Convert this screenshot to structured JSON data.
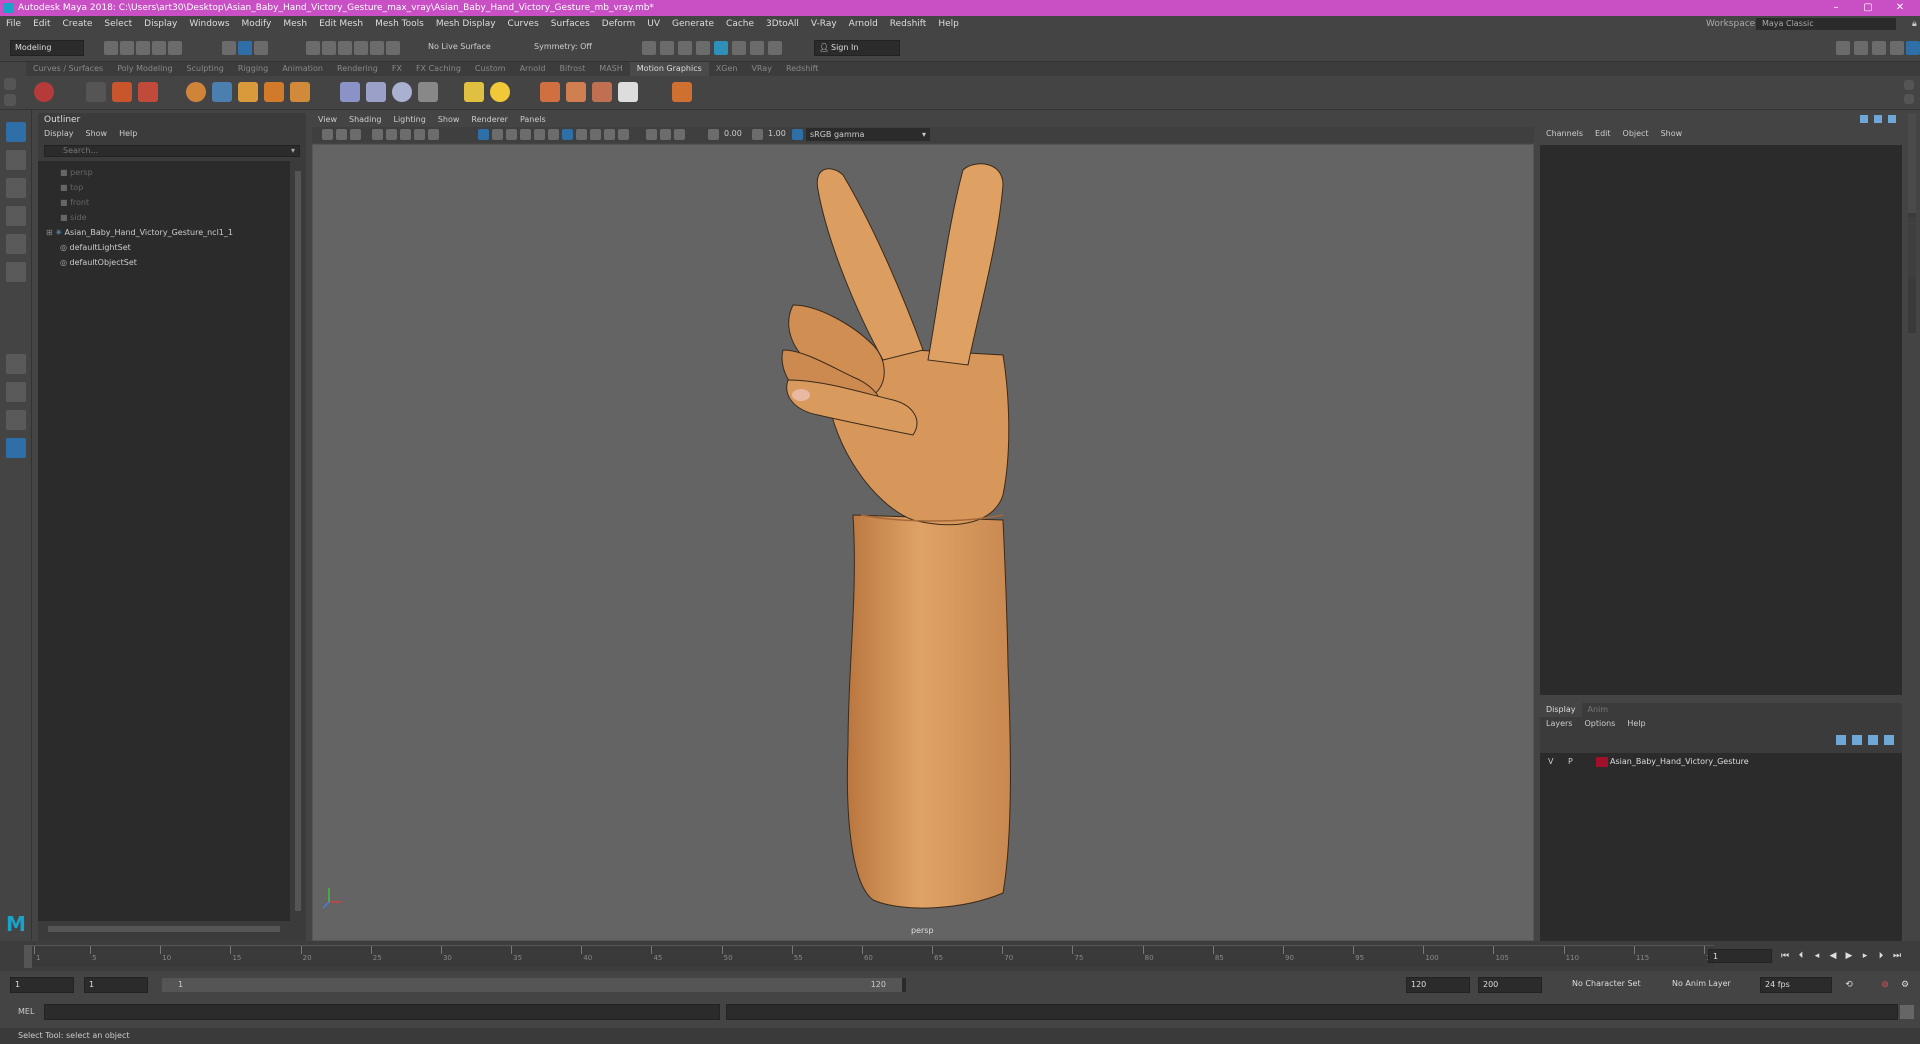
{
  "window": {
    "title": "Autodesk Maya 2018: C:\\Users\\art30\\Desktop\\Asian_Baby_Hand_Victory_Gesture_max_vray\\Asian_Baby_Hand_Victory_Gesture_mb_vray.mb*",
    "minimize": "–",
    "maximize": "▢",
    "close": "✕"
  },
  "menus": [
    "File",
    "Edit",
    "Create",
    "Select",
    "Display",
    "Windows",
    "Modify",
    "Mesh",
    "Edit Mesh",
    "Mesh Tools",
    "Mesh Display",
    "Curves",
    "Surfaces",
    "Deform",
    "UV",
    "Generate",
    "Cache",
    "3DtoAll",
    "V-Ray",
    "Arnold",
    "Redshift",
    "Help"
  ],
  "workspace": {
    "label": "Workspace :",
    "value": "Maya Classic"
  },
  "statusline": {
    "mode": "Modeling",
    "live_surface": "No Live Surface",
    "symmetry": "Symmetry: Off",
    "signin": "Sign In"
  },
  "shelf_tabs": [
    "Curves / Surfaces",
    "Poly Modeling",
    "Sculpting",
    "Rigging",
    "Animation",
    "Rendering",
    "FX",
    "FX Caching",
    "Custom",
    "Arnold",
    "Bifrost",
    "MASH",
    "Motion Graphics",
    "XGen",
    "VRay",
    "Redshift"
  ],
  "shelf_active": "Motion Graphics",
  "outliner": {
    "title": "Outliner",
    "menu": [
      "Display",
      "Show",
      "Help"
    ],
    "search_placeholder": "Search...",
    "items": [
      {
        "label": "persp",
        "dim": true
      },
      {
        "label": "top",
        "dim": true
      },
      {
        "label": "front",
        "dim": true
      },
      {
        "label": "side",
        "dim": true
      },
      {
        "label": "Asian_Baby_Hand_Victory_Gesture_ncl1_1",
        "dim": false
      },
      {
        "label": "defaultLightSet",
        "dim": false
      },
      {
        "label": "defaultObjectSet",
        "dim": false
      }
    ]
  },
  "viewport": {
    "menu": [
      "View",
      "Shading",
      "Lighting",
      "Show",
      "Renderer",
      "Panels"
    ],
    "exposure": "0.00",
    "gamma": "1.00",
    "color_space": "sRGB gamma",
    "camera_label": "persp"
  },
  "channel_box": {
    "menu": [
      "Channels",
      "Edit",
      "Object",
      "Show"
    ]
  },
  "layer_editor": {
    "tabs": [
      "Display",
      "Anim"
    ],
    "menu": [
      "Layers",
      "Options",
      "Help"
    ],
    "layer": {
      "v": "V",
      "p": "P",
      "name": "Asian_Baby_Hand_Victory_Gesture",
      "color": "#a0102a"
    }
  },
  "timeline": {
    "ticks": [
      1,
      5,
      10,
      15,
      20,
      25,
      30,
      35,
      40,
      45,
      50,
      55,
      60,
      65,
      70,
      75,
      80,
      85,
      90,
      95,
      100,
      105,
      110,
      115,
      120
    ],
    "current_frame": "1"
  },
  "range": {
    "start": "1",
    "start2": "1",
    "range_start_field": "1",
    "range_end_field": "120",
    "end": "120",
    "end2": "200",
    "char_set": "No Character Set",
    "anim_layer": "No Anim Layer",
    "fps": "24 fps"
  },
  "cmdline": {
    "label": "MEL"
  },
  "helpline": "Select Tool: select an object",
  "colors": {
    "title_bar": "#c84fc4",
    "skin": "#d99a5e",
    "layer_color": "#a0102a",
    "active_tool": "#2e6fa8"
  }
}
